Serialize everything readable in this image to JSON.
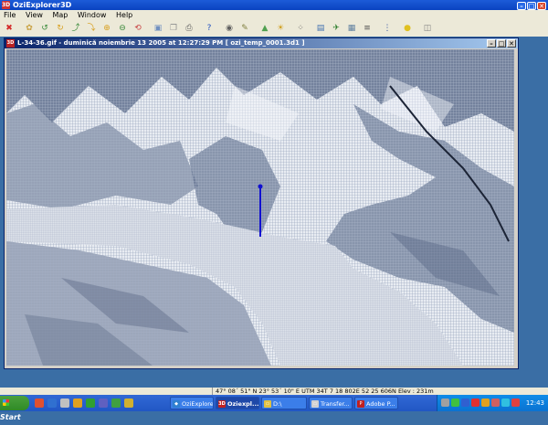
{
  "app": {
    "title": "OziExplorer3D"
  },
  "menu": {
    "items": [
      "File",
      "View",
      "Map",
      "Window",
      "Help"
    ]
  },
  "toolbar": {
    "buttons": [
      {
        "name": "close-tool-icon",
        "color": "#d42a2a",
        "glyph": "✖"
      },
      {
        "name": "palette-tool-icon",
        "color": "#c8a040",
        "glyph": "✿"
      },
      {
        "name": "rotate-left-tool-icon",
        "color": "#3a8a3a",
        "glyph": "↺"
      },
      {
        "name": "rotate-right-tool-icon",
        "color": "#d8a020",
        "glyph": "↻"
      },
      {
        "name": "tilt-up-tool-icon",
        "color": "#3a8a3a",
        "glyph": "⤴"
      },
      {
        "name": "tilt-down-tool-icon",
        "color": "#d8a020",
        "glyph": "⤵"
      },
      {
        "name": "zoom-in-tool-icon",
        "color": "#d8a020",
        "glyph": "⊕"
      },
      {
        "name": "zoom-out-tool-icon",
        "color": "#3a8a3a",
        "glyph": "⊖"
      },
      {
        "name": "reset-tool-icon",
        "color": "#c84040",
        "glyph": "⟲"
      },
      {
        "name": "image-tool-icon",
        "color": "#7090c0",
        "glyph": "▣"
      },
      {
        "name": "copy-tool-icon",
        "color": "#909090",
        "glyph": "❐"
      },
      {
        "name": "print-tool-icon",
        "color": "#606060",
        "glyph": "⎙"
      },
      {
        "name": "help-tool-icon",
        "color": "#2050c0",
        "glyph": "?"
      },
      {
        "name": "eye-tool-icon",
        "color": "#606060",
        "glyph": "◉"
      },
      {
        "name": "pencil-tool-icon",
        "color": "#808040",
        "glyph": "✎"
      },
      {
        "name": "mountain-tool-icon",
        "color": "#50a050",
        "glyph": "▲"
      },
      {
        "name": "sun-tool-icon",
        "color": "#d0a020",
        "glyph": "☀"
      },
      {
        "name": "dots-tool-icon",
        "color": "#606060",
        "glyph": "⁘"
      },
      {
        "name": "window-tool-icon",
        "color": "#4070b0",
        "glyph": "▤"
      },
      {
        "name": "plane-tool-icon",
        "color": "#308030",
        "glyph": "✈"
      },
      {
        "name": "grid-tool-icon",
        "color": "#6080a0",
        "glyph": "▦"
      },
      {
        "name": "wire-tool-icon",
        "color": "#505050",
        "glyph": "≡"
      },
      {
        "name": "mesh-tool-icon",
        "color": "#3050a0",
        "glyph": "⋮"
      },
      {
        "name": "light-tool-icon",
        "color": "#e0c020",
        "glyph": "●"
      },
      {
        "name": "settings-tool-icon",
        "color": "#808080",
        "glyph": "◫"
      }
    ]
  },
  "map_window": {
    "icon": "3D",
    "title": "L-34-36.gif - duminică noiembrie 13 2005  at  12:27:29 PM  [ ozi_temp_0001.3d1 ]"
  },
  "status": {
    "text": "47° 08´ 51\" N   23° 53´ 10\" E    UTM  34T    7 18 802E    52 25 606N    Elev : 231m"
  },
  "taskbar": {
    "start_label": "Start",
    "quick_launch": [
      "#e05030",
      "#3070d0",
      "#c0c0c0",
      "#e0a020",
      "#30a030",
      "#6060c0",
      "#40a040",
      "#d0b030"
    ],
    "tasks": [
      {
        "label": "OziExplorer",
        "icon": "#3080d0",
        "glyph": "◆",
        "active": false
      },
      {
        "label": "Oziexpl...",
        "icon": "#c02020",
        "glyph": "3D",
        "active": true
      },
      {
        "label": "D:\\",
        "icon": "#e0c040",
        "glyph": "▭",
        "active": false
      },
      {
        "label": "Transfer...",
        "icon": "#d0d0d0",
        "glyph": "▭",
        "active": false
      },
      {
        "label": "Adobe P...",
        "icon": "#c02020",
        "glyph": "P",
        "active": false
      }
    ],
    "tray_icons": [
      "#a0a0a0",
      "#40c040",
      "#3060d0",
      "#e03030",
      "#e0a020",
      "#d06060",
      "#30c0e0",
      "#e04040"
    ],
    "clock": "12:43"
  }
}
